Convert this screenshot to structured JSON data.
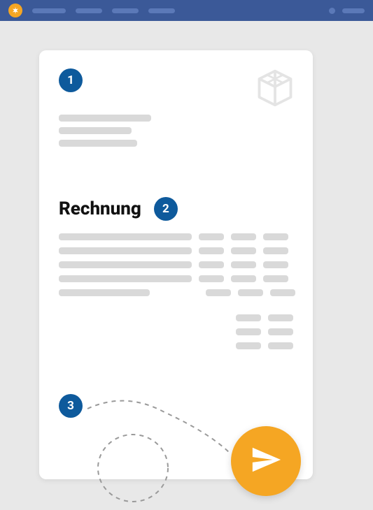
{
  "document": {
    "title": "Rechnung"
  },
  "badges": {
    "b1": "1",
    "b2": "2",
    "b3": "3"
  },
  "colors": {
    "topbar": "#3B5998",
    "badge": "#0E5A9C",
    "accent": "#F5A623",
    "placeholder": "#D9D9D9"
  },
  "icons": {
    "logo": "asterisk-icon",
    "doc_logo": "cube-icon",
    "send": "paper-plane-icon"
  }
}
